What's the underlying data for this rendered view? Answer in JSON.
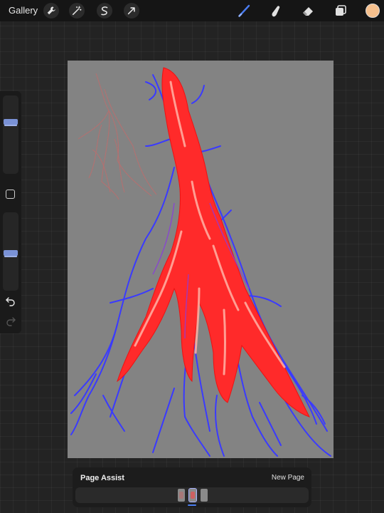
{
  "topbar": {
    "gallery_label": "Gallery",
    "left_tools": [
      "wrench-icon",
      "magic-wand-icon",
      "selection-icon",
      "transform-arrow-icon"
    ],
    "right_tools": [
      "brush-icon",
      "smudge-icon",
      "eraser-icon",
      "layers-icon"
    ],
    "active_tool": "brush-icon",
    "active_tool_color": "#4a7cf0",
    "current_color": "#f6c08d"
  },
  "sidebar": {
    "brush_size": 0.7,
    "brush_opacity": 0.5
  },
  "canvas": {
    "background": "#838383",
    "stroke_colors": [
      "#ff2a2a",
      "#3a3aff",
      "#ffb3a6",
      "#e06060"
    ]
  },
  "page_assist": {
    "title": "Page Assist",
    "new_page_label": "New Page",
    "page_count": 3,
    "active_page": 2
  }
}
